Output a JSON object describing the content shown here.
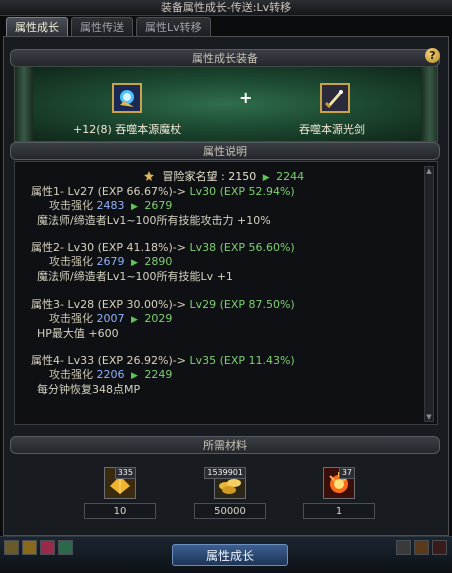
{
  "window": {
    "title": "装备属性成长-传送:Lv转移"
  },
  "tabs": [
    {
      "label": "属性成长"
    },
    {
      "label": "属性传送"
    },
    {
      "label": "属性Lv转移"
    }
  ],
  "help_label": "?",
  "equip_section": {
    "header": "属性成长装备",
    "plus": "+",
    "source": {
      "enhance": "+12(8)",
      "name": "吞噬本源魔杖"
    },
    "target": {
      "name": "吞噬本源光剑"
    }
  },
  "stats_section": {
    "header": "属性说明",
    "fame": {
      "label": "冒险家名望 :",
      "current": "2150",
      "next": "2244"
    },
    "attributes": [
      {
        "name": "属性1-",
        "lv_from": "Lv27",
        "exp_from": "(EXP 66.67%)->",
        "lv_to": "Lv30",
        "exp_to": "(EXP 52.94%)",
        "stat_label": "攻击强化",
        "stat_from": "2483",
        "stat_to": "2679",
        "effect": "魔法师/缔造者Lv1~100所有技能攻击力 +10%"
      },
      {
        "name": "属性2-",
        "lv_from": "Lv30",
        "exp_from": "(EXP 41.18%)->",
        "lv_to": "Lv38",
        "exp_to": "(EXP 56.60%)",
        "stat_label": "攻击强化",
        "stat_from": "2679",
        "stat_to": "2890",
        "effect": "魔法师/缔造者Lv1~100所有技能Lv +1"
      },
      {
        "name": "属性3-",
        "lv_from": "Lv28",
        "exp_from": "(EXP 30.00%)->",
        "lv_to": "Lv29",
        "exp_to": "(EXP 87.50%)",
        "stat_label": "攻击强化",
        "stat_from": "2007",
        "stat_to": "2029",
        "effect": "HP最大值 +600"
      },
      {
        "name": "属性4-",
        "lv_from": "Lv33",
        "exp_from": "(EXP 26.92%)->",
        "lv_to": "Lv35",
        "exp_to": "(EXP 11.43%)",
        "stat_label": "攻击强化",
        "stat_from": "2206",
        "stat_to": "2249",
        "effect": "每分钟恢复348点MP"
      }
    ]
  },
  "materials_section": {
    "header": "所需材料",
    "items": [
      {
        "icon": "gold-crystal-icon",
        "owned": "335",
        "required": "10"
      },
      {
        "icon": "gold-coins-icon",
        "owned": "1539901",
        "required": "50000"
      },
      {
        "icon": "flame-orb-icon",
        "owned": "37",
        "required": "1"
      }
    ]
  },
  "action_button": "属性成长",
  "colors": {
    "accent_green": "#7ed070",
    "stat_blue": "#8fb3ff",
    "gold_border": "#c9a24a"
  }
}
